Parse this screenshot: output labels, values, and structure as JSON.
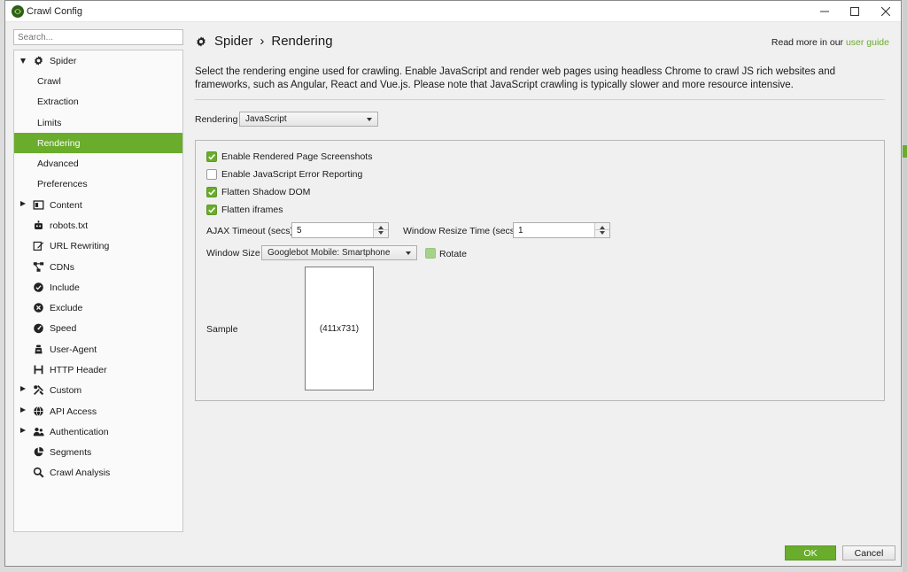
{
  "window": {
    "title": "Crawl Config"
  },
  "sidebar": {
    "search_placeholder": "Search...",
    "items": [
      {
        "label": "Spider",
        "icon": "gear-icon",
        "level": "top",
        "caret": "down"
      },
      {
        "label": "Crawl",
        "level": "sub"
      },
      {
        "label": "Extraction",
        "level": "sub"
      },
      {
        "label": "Limits",
        "level": "sub"
      },
      {
        "label": "Rendering",
        "level": "sub",
        "selected": true
      },
      {
        "label": "Advanced",
        "level": "sub"
      },
      {
        "label": "Preferences",
        "level": "sub"
      },
      {
        "label": "Content",
        "icon": "content-icon",
        "level": "top",
        "caret": "right"
      },
      {
        "label": "robots.txt",
        "icon": "robot-icon",
        "level": "top"
      },
      {
        "label": "URL Rewriting",
        "icon": "edit-icon",
        "level": "top"
      },
      {
        "label": "CDNs",
        "icon": "network-icon",
        "level": "top"
      },
      {
        "label": "Include",
        "icon": "check-circle-icon",
        "level": "top"
      },
      {
        "label": "Exclude",
        "icon": "x-circle-icon",
        "level": "top"
      },
      {
        "label": "Speed",
        "icon": "speedometer-icon",
        "level": "top"
      },
      {
        "label": "User-Agent",
        "icon": "user-agent-icon",
        "level": "top"
      },
      {
        "label": "HTTP Header",
        "icon": "header-icon",
        "level": "top"
      },
      {
        "label": "Custom",
        "icon": "tools-icon",
        "level": "top",
        "caret": "right"
      },
      {
        "label": "API Access",
        "icon": "globe-icon",
        "level": "top",
        "caret": "right"
      },
      {
        "label": "Authentication",
        "icon": "users-icon",
        "level": "top",
        "caret": "right"
      },
      {
        "label": "Segments",
        "icon": "pie-chart-icon",
        "level": "top"
      },
      {
        "label": "Crawl Analysis",
        "icon": "search-icon",
        "level": "top"
      }
    ]
  },
  "header": {
    "section": "Spider",
    "separator": "›",
    "page": "Rendering",
    "read_more_prefix": "Read more in our",
    "read_more_link": "user guide"
  },
  "description": "Select the rendering engine used for crawling. Enable JavaScript and render web pages using headless Chrome to crawl JS rich websites and frameworks, such as Angular, React and Vue.js. Please note that JavaScript crawling is typically slower and more resource intensive.",
  "rendering": {
    "label": "Rendering",
    "value": "JavaScript"
  },
  "options": {
    "screenshots": {
      "label": "Enable Rendered Page Screenshots",
      "checked": true
    },
    "js_errors": {
      "label": "Enable JavaScript Error Reporting",
      "checked": false
    },
    "shadow_dom": {
      "label": "Flatten Shadow DOM",
      "checked": true
    },
    "iframes": {
      "label": "Flatten iframes",
      "checked": true
    }
  },
  "ajax_timeout": {
    "label": "AJAX Timeout (secs)",
    "value": "5"
  },
  "window_resize": {
    "label": "Window Resize Time (secs)",
    "value": "1"
  },
  "window_size": {
    "label": "Window Size",
    "value": "Googlebot Mobile: Smartphone"
  },
  "rotate": {
    "label": "Rotate",
    "checked": false
  },
  "sample": {
    "label": "Sample",
    "dimensions": "(411x731)"
  },
  "footer": {
    "ok": "OK",
    "cancel": "Cancel"
  },
  "colors": {
    "accent": "#6aac2c"
  }
}
